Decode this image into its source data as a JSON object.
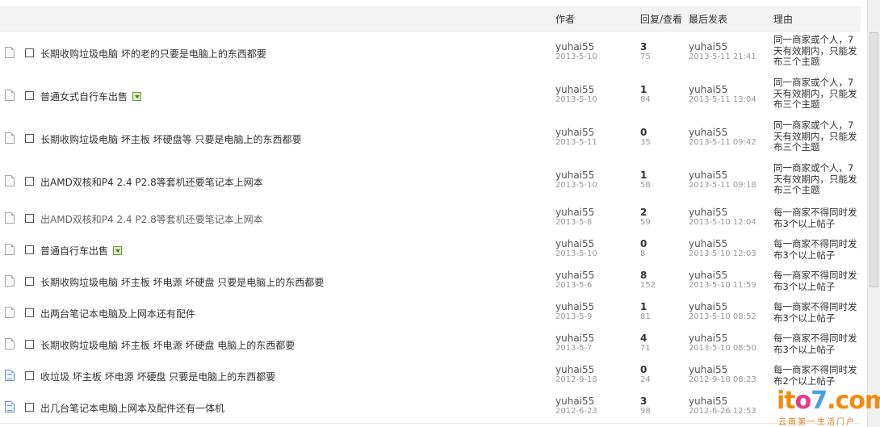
{
  "header": {
    "author": "作者",
    "replies_views": "回复/查看",
    "last_post": "最后发表",
    "reason": "理由"
  },
  "rows": [
    {
      "title": "长期收购垃圾电脑 坏的老的只要是电脑上的东西都要",
      "has_image": false,
      "icon": "doc",
      "title_gray": false,
      "author": "yuhai55",
      "date": "2013-5-10",
      "replies": "3",
      "views": "75",
      "last_user": "yuhai55",
      "last_time": "2013-5-11 21:41",
      "reason": "同一商家或个人，7天有效期内，只能发布三个主题"
    },
    {
      "title": "普通女式自行车出售",
      "has_image": true,
      "icon": "doc",
      "title_gray": false,
      "author": "yuhai55",
      "date": "2013-5-10",
      "replies": "1",
      "views": "84",
      "last_user": "yuhai55",
      "last_time": "2013-5-11 13:04",
      "reason": "同一商家或个人，7天有效期内，只能发布三个主题"
    },
    {
      "title": "长期收购垃圾电脑 坏主板 坏硬盘等 只要是电脑上的东西都要",
      "has_image": false,
      "icon": "doc",
      "title_gray": false,
      "author": "yuhai55",
      "date": "2013-5-11",
      "replies": "0",
      "views": "35",
      "last_user": "yuhai55",
      "last_time": "2013-5-11 09:42",
      "reason": "同一商家或个人，7天有效期内，只能发布三个主题"
    },
    {
      "title": "出AMD双核和P4 2.4 P2.8等套机还要笔记本上网本",
      "has_image": false,
      "icon": "doc",
      "title_gray": false,
      "author": "yuhai55",
      "date": "2013-5-10",
      "replies": "1",
      "views": "58",
      "last_user": "yuhai55",
      "last_time": "2013-5-11 09:18",
      "reason": "同一商家或个人，7天有效期内，只能发布三个主题"
    },
    {
      "title": "出AMD双核和P4 2.4 P2.8等套机还要笔记本上网本",
      "has_image": false,
      "icon": "doc",
      "title_gray": true,
      "author": "yuhai55",
      "date": "2013-5-8",
      "replies": "2",
      "views": "59",
      "last_user": "yuhai55",
      "last_time": "2013-5-10 12:04",
      "reason": "每一商家不得同时发布3个以上帖子"
    },
    {
      "title": "普通自行车出售",
      "has_image": true,
      "icon": "doc",
      "title_gray": false,
      "author": "yuhai55",
      "date": "2013-5-10",
      "replies": "0",
      "views": "8",
      "last_user": "yuhai55",
      "last_time": "2013-5-10 12:03",
      "reason": "每一商家不得同时发布3个以上帖子"
    },
    {
      "title": "长期收购垃圾电脑 坏主板 坏电源 坏硬盘 只要是电脑上的东西都要",
      "has_image": false,
      "icon": "doc",
      "title_gray": false,
      "author": "yuhai55",
      "date": "2013-5-6",
      "replies": "8",
      "views": "152",
      "last_user": "yuhai55",
      "last_time": "2013-5-10 11:59",
      "reason": "每一商家不得同时发布3个以上帖子"
    },
    {
      "title": "出两台笔记本电脑及上网本还有配件",
      "has_image": false,
      "icon": "doc",
      "title_gray": false,
      "author": "yuhai55",
      "date": "2013-5-9",
      "replies": "1",
      "views": "81",
      "last_user": "yuhai55",
      "last_time": "2013-5-10 08:52",
      "reason": "每一商家不得同时发布3个以上帖子"
    },
    {
      "title": "长期收购垃圾电脑 坏主板 坏电源 坏硬盘 电脑上的东西都要",
      "has_image": false,
      "icon": "doc",
      "title_gray": false,
      "author": "yuhai55",
      "date": "2013-5-7",
      "replies": "4",
      "views": "71",
      "last_user": "yuhai55",
      "last_time": "2013-5-10 08:50",
      "reason": "每一商家不得同时发布3个以上帖子"
    },
    {
      "title": "收垃圾 坏主板 坏电源 坏硬盘 只要是电脑上的东西都要",
      "has_image": false,
      "icon": "doc-blue",
      "title_gray": false,
      "author": "yuhai55",
      "date": "2012-9-18",
      "replies": "0",
      "views": "24",
      "last_user": "yuhai55",
      "last_time": "2012-9-18 08:23",
      "reason": "每一商家不得同时发布2个以上帖子"
    },
    {
      "title": "出几台笔记本电脑上网本及配件还有一体机",
      "has_image": false,
      "icon": "doc-blue",
      "title_gray": false,
      "author": "yuhai55",
      "date": "2012-6-23",
      "replies": "3",
      "views": "98",
      "last_user": "yuhai55",
      "last_time": "2012-6-26 12:53",
      "reason": ""
    }
  ],
  "watermark": {
    "text_a": "it",
    "text_b": "o",
    "text_c": "7",
    "text_d": ".com",
    "subtitle": "云南第一生活门户"
  },
  "colors": {
    "header_bg": "#f3f3f3",
    "row_border": "#e9e9e9",
    "watermark_orange": "#f08c10",
    "watermark_pink": "#e23b8b",
    "watermark_blue": "#45a3df"
  }
}
